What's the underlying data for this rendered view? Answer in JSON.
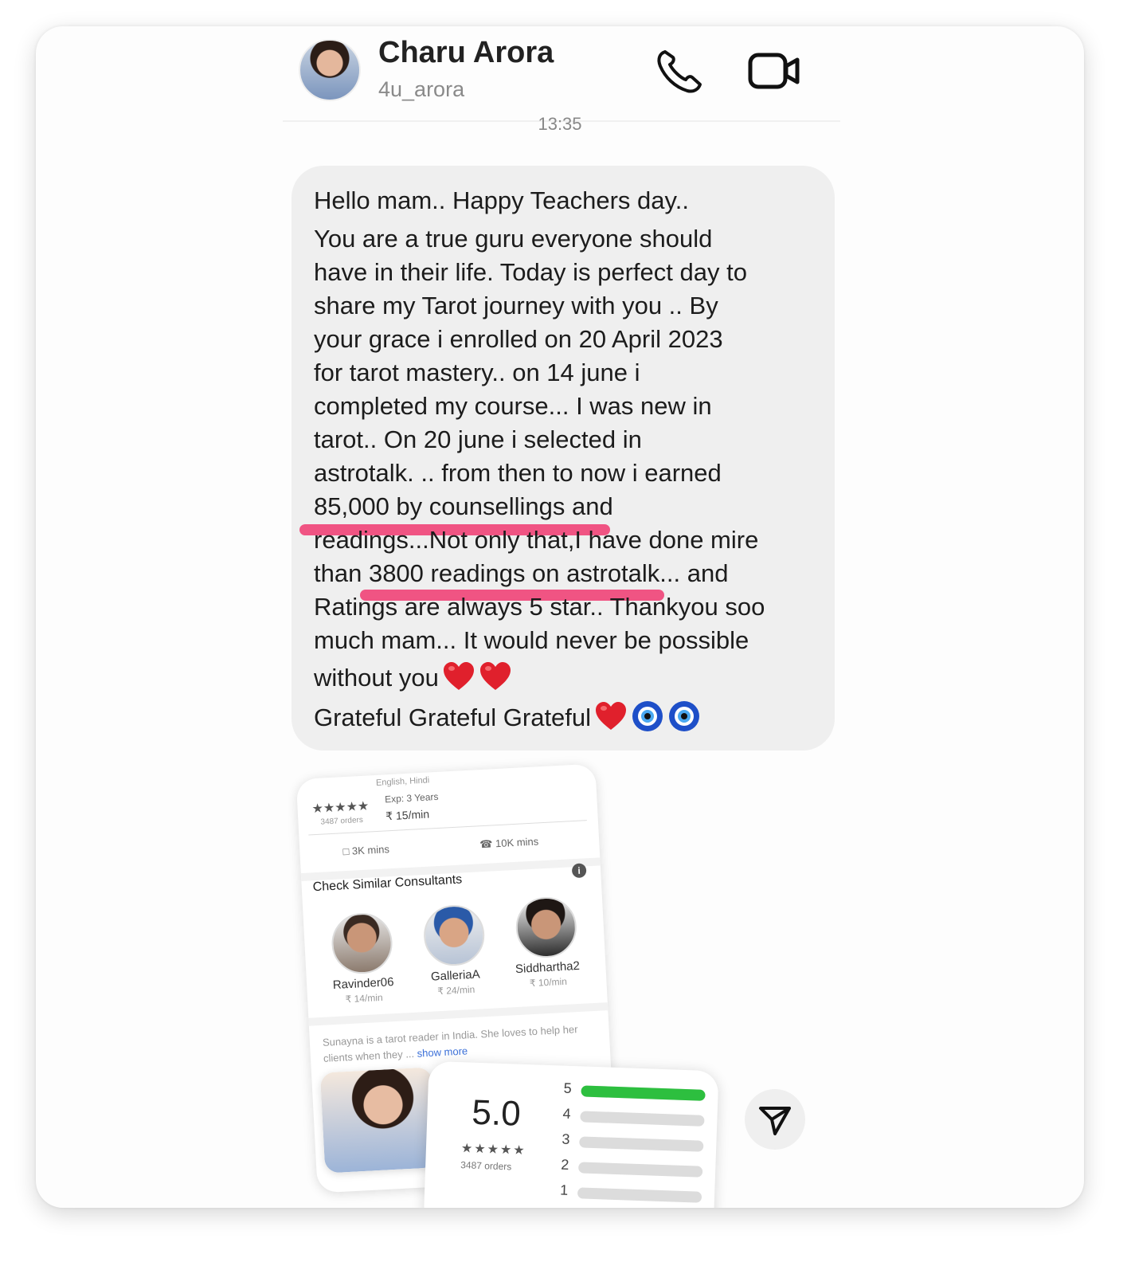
{
  "header": {
    "name": "Charu Arora",
    "handle": "4u_arora",
    "call_icon": "phone-icon",
    "video_icon": "video-camera-icon"
  },
  "timestamp": "13:35",
  "message": {
    "lines": [
      "Hello mam.. Happy Teachers day..",
      "You are a true guru everyone should",
      "have in their life. Today is perfect day to",
      "share my Tarot journey with you .. By",
      "your grace i enrolled on 20 April 2023",
      "for tarot mastery.. on 14 june i",
      "completed my course... I was new in",
      "tarot.. On 20 june i selected in",
      "astrotalk. .. from then to now i earned",
      "85,000 by counsellings and",
      "readings...Not only that,I have done mire",
      "than 3800 readings on astrotalk... and",
      "Ratings are always 5 star.. Thankyou soo",
      "much mam... It would never be possible",
      "without you",
      "Grateful Grateful Grateful"
    ],
    "emojis": [
      "red-heart",
      "red-heart",
      "red-heart",
      "nazar-amulet",
      "nazar-amulet"
    ],
    "highlight_color": "#f0467a"
  },
  "attachment": {
    "profile": {
      "stars": "★★★★★",
      "orders": "3487 orders",
      "exp": "Exp: 3 Years",
      "rate": "₹ 15/min",
      "chat_mins": "3K mins",
      "call_mins": "10K mins",
      "top_partial": "English, Hindi"
    },
    "similar_title": "Check Similar Consultants",
    "consultants": [
      {
        "name": "Ravinder06",
        "rate": "₹ 14/min"
      },
      {
        "name": "GalleriaA",
        "rate": "₹ 24/min"
      },
      {
        "name": "Siddhartha2",
        "rate": "₹ 10/min"
      }
    ],
    "bio": "Sunayna is a tarot reader in India. She loves to help her clients when they ...",
    "show_more": "show more",
    "rating": {
      "score": "5.0",
      "stars": "★★★★★",
      "orders": "3487 orders",
      "bars": [
        {
          "label": "5",
          "fill": 1.0
        },
        {
          "label": "4",
          "fill": 0.0
        },
        {
          "label": "3",
          "fill": 0.0
        },
        {
          "label": "2",
          "fill": 0.0
        },
        {
          "label": "1",
          "fill": 0.0
        }
      ],
      "fill_color": "#2dbf3f"
    }
  },
  "send_icon": "send-paper-plane-icon"
}
